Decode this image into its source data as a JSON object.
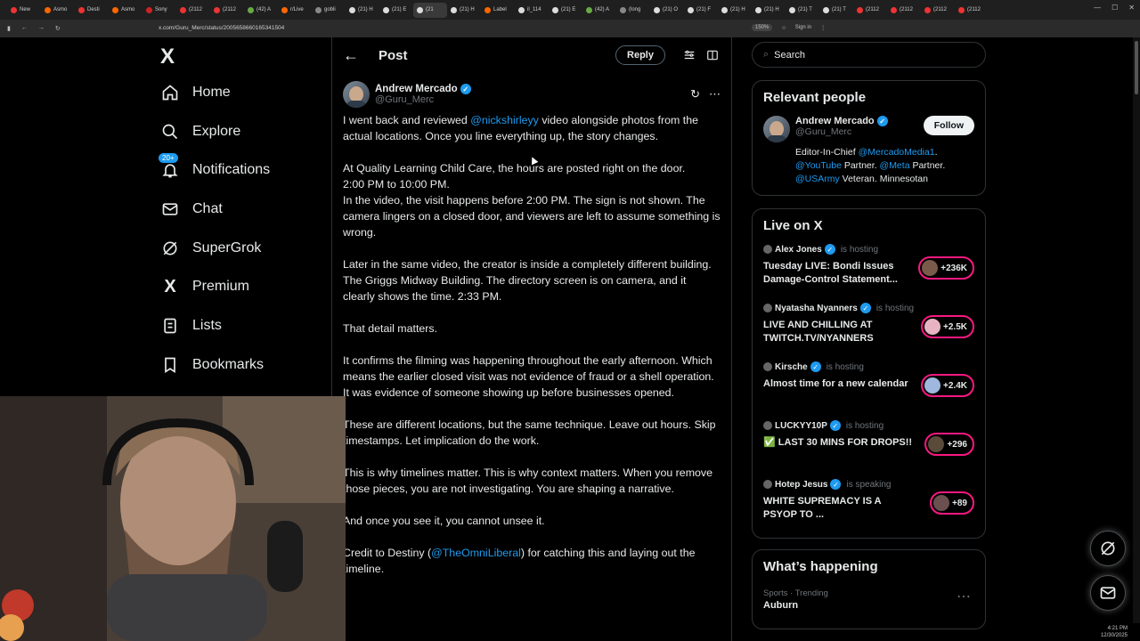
{
  "browser": {
    "tabs": [
      "New",
      "Asmo",
      "Desti",
      "Asmo",
      "Sony",
      "(2112",
      "(2112",
      "(42) A",
      "r/Live",
      "gobli",
      "(21) H",
      "(21) E",
      "(21",
      "(21) H",
      "Label",
      "il_114",
      "(21) E",
      "(42) A",
      "(long",
      "(21) O",
      "(21) F",
      "(21) H",
      "(21) H",
      "(21) T",
      "(21) T",
      "(2112",
      "(2112",
      "(2112",
      "(2112"
    ],
    "url": "x.com/Guru_Merc/status/2005658660165341504",
    "zoom": "150%",
    "signin": "Sign in"
  },
  "nav": {
    "logo": "X",
    "items": [
      {
        "label": "Home",
        "icon": "home-icon"
      },
      {
        "label": "Explore",
        "icon": "search-icon"
      },
      {
        "label": "Notifications",
        "icon": "bell-icon",
        "badge": "20+"
      },
      {
        "label": "Chat",
        "icon": "mail-icon"
      },
      {
        "label": "SuperGrok",
        "icon": "grok-icon"
      },
      {
        "label": "Premium",
        "icon": "x-icon"
      },
      {
        "label": "Lists",
        "icon": "list-icon"
      },
      {
        "label": "Bookmarks",
        "icon": "bookmark-icon"
      }
    ]
  },
  "main": {
    "header_title": "Post",
    "reply_label": "Reply",
    "author_name": "Andrew Mercado",
    "author_handle": "@Guru_Merc",
    "post": {
      "p1_a": "I went back and reviewed ",
      "p1_mention": "@nickshirleyy",
      "p1_b": " video alongside photos from the actual locations. Once you line everything up, the story changes.",
      "p2_l1": "At Quality Learning Child Care, the hours are posted right on the door.",
      "p2_l2": "2:00 PM to 10:00 PM.",
      "p2_l3": "In the video, the visit happens before 2:00 PM. The sign is not shown. The camera lingers on a closed door, and viewers are left to assume something is wrong.",
      "p3": "Later in the same video, the creator is inside a completely different building. The Griggs Midway Building. The directory screen is on camera, and it clearly shows the time. 2:33 PM.",
      "p4": "That detail matters.",
      "p5": "It confirms the filming was happening throughout the early afternoon. Which means the earlier closed visit was not evidence of fraud or a shell operation. It was evidence of someone showing up before businesses opened.",
      "p6": "These are different locations, but the same technique. Leave out hours. Skip timestamps. Let implication do the work.",
      "p7": "This is why timelines matter. This is why context matters. When you remove those pieces, you are not investigating. You are shaping a narrative.",
      "p8": "And once you see it, you cannot unsee it.",
      "p9_a": "Credit to Destiny (",
      "p9_mention": "@TheOmniLiberal",
      "p9_b": ") for catching this and laying out the timeline."
    }
  },
  "right": {
    "search_placeholder": "Search",
    "relevant_title": "Relevant people",
    "person": {
      "name": "Andrew Mercado",
      "handle": "@Guru_Merc",
      "follow_label": "Follow",
      "bio_a": "Editor-In-Chief ",
      "bio_m1": "@MercadoMedia1",
      "bio_b": ". ",
      "bio_m2": "@YouTube",
      "bio_c": " Partner. ",
      "bio_m3": "@Meta",
      "bio_d": " Partner. ",
      "bio_m4": "@USArmy",
      "bio_e": " Veteran. Minnesotan"
    },
    "live_title": "Live on X",
    "live": [
      {
        "host": "Alex Jones",
        "status": "is hosting",
        "title": "Tuesday LIVE: Bondi Issues Damage-Control Statement...",
        "count": "+236K"
      },
      {
        "host": "Nyatasha Nyanners",
        "status": "is hosting",
        "title": "LIVE AND CHILLING AT TWITCH.TV/NYANNERS",
        "count": "+2.5K"
      },
      {
        "host": "Kirsche",
        "status": "is hosting",
        "title": "Almost time for a new calendar",
        "count": "+2.4K"
      },
      {
        "host": "LUCKYY10P",
        "status": "is hosting",
        "title": "✅ LAST 30 MINS FOR DROPS!!",
        "count": "+296"
      },
      {
        "host": "Hotep Jesus",
        "status": "is speaking",
        "title": "WHITE SUPREMACY IS A PSYOP TO ...",
        "count": "+89"
      }
    ],
    "whats_title": "What’s happening",
    "trend_meta": "Sports · Trending",
    "trend_name": "Auburn"
  },
  "taskbar": {
    "time": "4:21 PM",
    "date": "12/30/2025"
  },
  "colors": {
    "accent": "#1d9bf0",
    "live_ring": "#f91880",
    "background": "#000000"
  }
}
